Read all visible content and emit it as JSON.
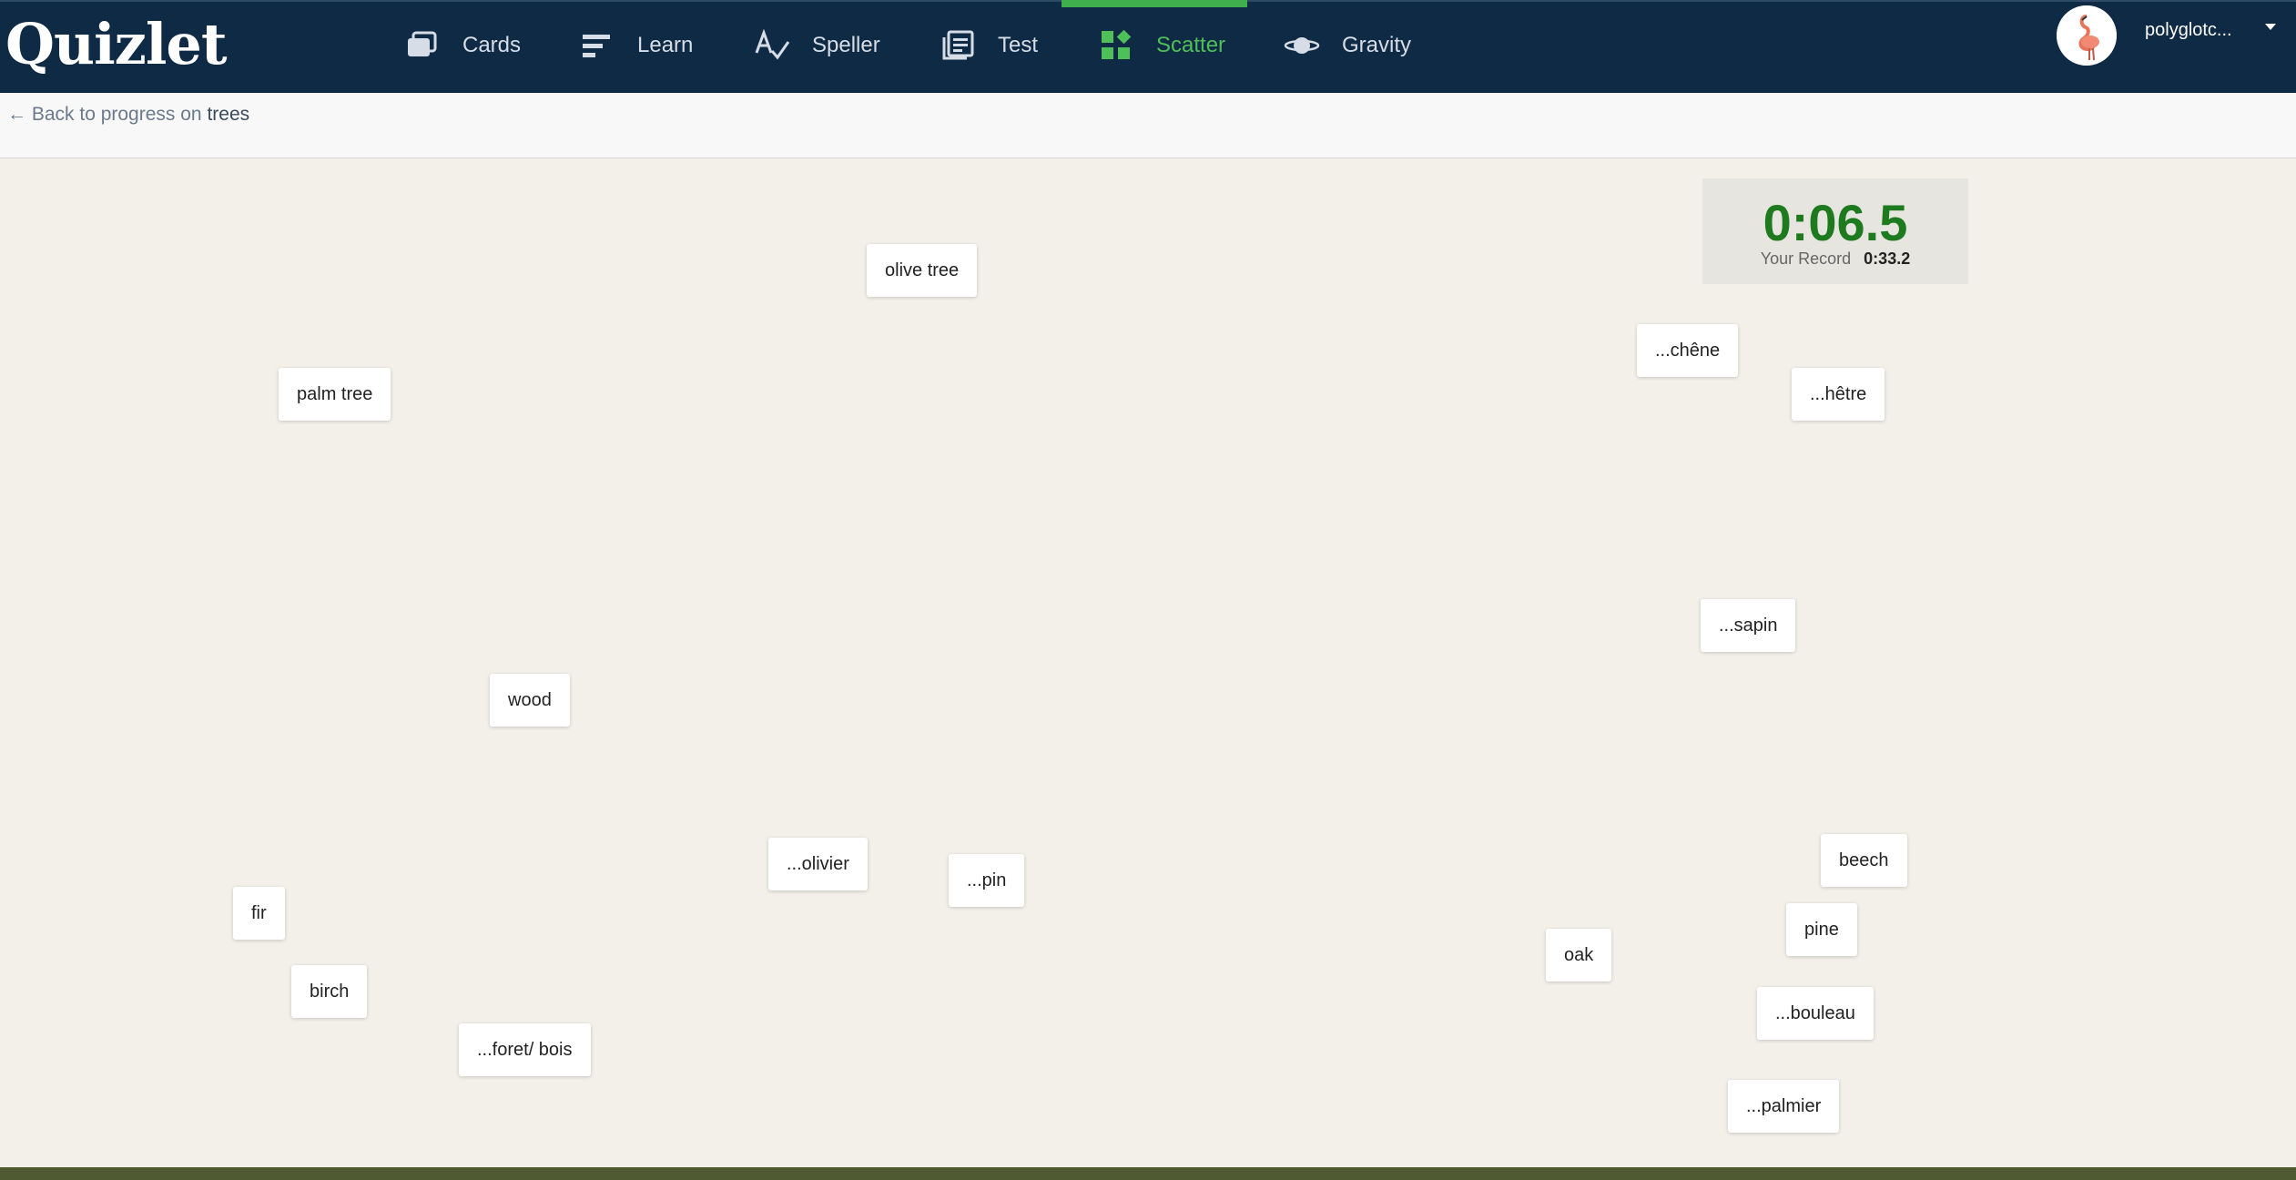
{
  "app": {
    "logo": "Quizlet"
  },
  "nav": [
    {
      "label": "Cards",
      "icon": "cards-icon"
    },
    {
      "label": "Learn",
      "icon": "learn-icon"
    },
    {
      "label": "Speller",
      "icon": "speller-icon"
    },
    {
      "label": "Test",
      "icon": "test-icon"
    },
    {
      "label": "Scatter",
      "icon": "scatter-icon",
      "active": true
    },
    {
      "label": "Gravity",
      "icon": "gravity-icon"
    }
  ],
  "user": {
    "name": "polyglotc..."
  },
  "breadcrumb": {
    "prefix": "← Back to progress on ",
    "set_name": "trees"
  },
  "timer": {
    "value": "0:06.5",
    "record_label": "Your Record",
    "record_value": "0:33.2"
  },
  "tiles": [
    "olive tree",
    "...chêne",
    "...hêtre",
    "palm tree",
    "...sapin",
    "wood",
    "...olivier",
    "...pin",
    "beech",
    "fir",
    "pine",
    "oak",
    "birch",
    "...bouleau",
    "...foret/ bois",
    "...palmier"
  ],
  "colors": {
    "nav_bg": "#0f2a44",
    "active": "#4fbf5a",
    "timer": "#1e7a1e",
    "board_bg": "#f3f0e9"
  }
}
